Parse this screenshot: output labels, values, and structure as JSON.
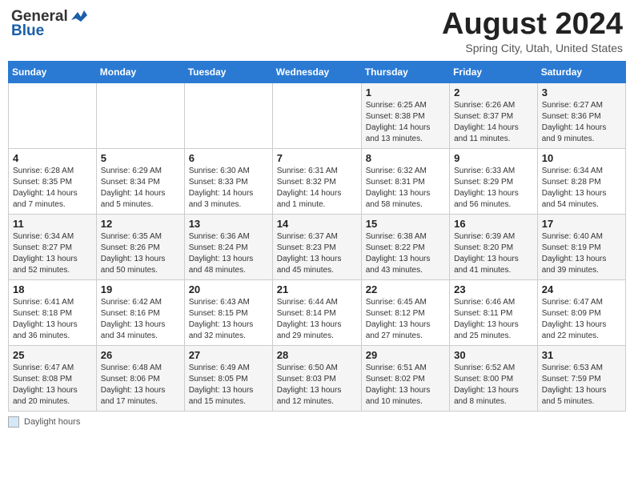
{
  "header": {
    "logo_general": "General",
    "logo_blue": "Blue",
    "month_title": "August 2024",
    "location": "Spring City, Utah, United States"
  },
  "weekdays": [
    "Sunday",
    "Monday",
    "Tuesday",
    "Wednesday",
    "Thursday",
    "Friday",
    "Saturday"
  ],
  "footer": {
    "legend_label": "Daylight hours"
  },
  "weeks": [
    [
      {
        "day": "",
        "info": ""
      },
      {
        "day": "",
        "info": ""
      },
      {
        "day": "",
        "info": ""
      },
      {
        "day": "",
        "info": ""
      },
      {
        "day": "1",
        "info": "Sunrise: 6:25 AM\nSunset: 8:38 PM\nDaylight: 14 hours and 13 minutes."
      },
      {
        "day": "2",
        "info": "Sunrise: 6:26 AM\nSunset: 8:37 PM\nDaylight: 14 hours and 11 minutes."
      },
      {
        "day": "3",
        "info": "Sunrise: 6:27 AM\nSunset: 8:36 PM\nDaylight: 14 hours and 9 minutes."
      }
    ],
    [
      {
        "day": "4",
        "info": "Sunrise: 6:28 AM\nSunset: 8:35 PM\nDaylight: 14 hours and 7 minutes."
      },
      {
        "day": "5",
        "info": "Sunrise: 6:29 AM\nSunset: 8:34 PM\nDaylight: 14 hours and 5 minutes."
      },
      {
        "day": "6",
        "info": "Sunrise: 6:30 AM\nSunset: 8:33 PM\nDaylight: 14 hours and 3 minutes."
      },
      {
        "day": "7",
        "info": "Sunrise: 6:31 AM\nSunset: 8:32 PM\nDaylight: 14 hours and 1 minute."
      },
      {
        "day": "8",
        "info": "Sunrise: 6:32 AM\nSunset: 8:31 PM\nDaylight: 13 hours and 58 minutes."
      },
      {
        "day": "9",
        "info": "Sunrise: 6:33 AM\nSunset: 8:29 PM\nDaylight: 13 hours and 56 minutes."
      },
      {
        "day": "10",
        "info": "Sunrise: 6:34 AM\nSunset: 8:28 PM\nDaylight: 13 hours and 54 minutes."
      }
    ],
    [
      {
        "day": "11",
        "info": "Sunrise: 6:34 AM\nSunset: 8:27 PM\nDaylight: 13 hours and 52 minutes."
      },
      {
        "day": "12",
        "info": "Sunrise: 6:35 AM\nSunset: 8:26 PM\nDaylight: 13 hours and 50 minutes."
      },
      {
        "day": "13",
        "info": "Sunrise: 6:36 AM\nSunset: 8:24 PM\nDaylight: 13 hours and 48 minutes."
      },
      {
        "day": "14",
        "info": "Sunrise: 6:37 AM\nSunset: 8:23 PM\nDaylight: 13 hours and 45 minutes."
      },
      {
        "day": "15",
        "info": "Sunrise: 6:38 AM\nSunset: 8:22 PM\nDaylight: 13 hours and 43 minutes."
      },
      {
        "day": "16",
        "info": "Sunrise: 6:39 AM\nSunset: 8:20 PM\nDaylight: 13 hours and 41 minutes."
      },
      {
        "day": "17",
        "info": "Sunrise: 6:40 AM\nSunset: 8:19 PM\nDaylight: 13 hours and 39 minutes."
      }
    ],
    [
      {
        "day": "18",
        "info": "Sunrise: 6:41 AM\nSunset: 8:18 PM\nDaylight: 13 hours and 36 minutes."
      },
      {
        "day": "19",
        "info": "Sunrise: 6:42 AM\nSunset: 8:16 PM\nDaylight: 13 hours and 34 minutes."
      },
      {
        "day": "20",
        "info": "Sunrise: 6:43 AM\nSunset: 8:15 PM\nDaylight: 13 hours and 32 minutes."
      },
      {
        "day": "21",
        "info": "Sunrise: 6:44 AM\nSunset: 8:14 PM\nDaylight: 13 hours and 29 minutes."
      },
      {
        "day": "22",
        "info": "Sunrise: 6:45 AM\nSunset: 8:12 PM\nDaylight: 13 hours and 27 minutes."
      },
      {
        "day": "23",
        "info": "Sunrise: 6:46 AM\nSunset: 8:11 PM\nDaylight: 13 hours and 25 minutes."
      },
      {
        "day": "24",
        "info": "Sunrise: 6:47 AM\nSunset: 8:09 PM\nDaylight: 13 hours and 22 minutes."
      }
    ],
    [
      {
        "day": "25",
        "info": "Sunrise: 6:47 AM\nSunset: 8:08 PM\nDaylight: 13 hours and 20 minutes."
      },
      {
        "day": "26",
        "info": "Sunrise: 6:48 AM\nSunset: 8:06 PM\nDaylight: 13 hours and 17 minutes."
      },
      {
        "day": "27",
        "info": "Sunrise: 6:49 AM\nSunset: 8:05 PM\nDaylight: 13 hours and 15 minutes."
      },
      {
        "day": "28",
        "info": "Sunrise: 6:50 AM\nSunset: 8:03 PM\nDaylight: 13 hours and 12 minutes."
      },
      {
        "day": "29",
        "info": "Sunrise: 6:51 AM\nSunset: 8:02 PM\nDaylight: 13 hours and 10 minutes."
      },
      {
        "day": "30",
        "info": "Sunrise: 6:52 AM\nSunset: 8:00 PM\nDaylight: 13 hours and 8 minutes."
      },
      {
        "day": "31",
        "info": "Sunrise: 6:53 AM\nSunset: 7:59 PM\nDaylight: 13 hours and 5 minutes."
      }
    ]
  ]
}
